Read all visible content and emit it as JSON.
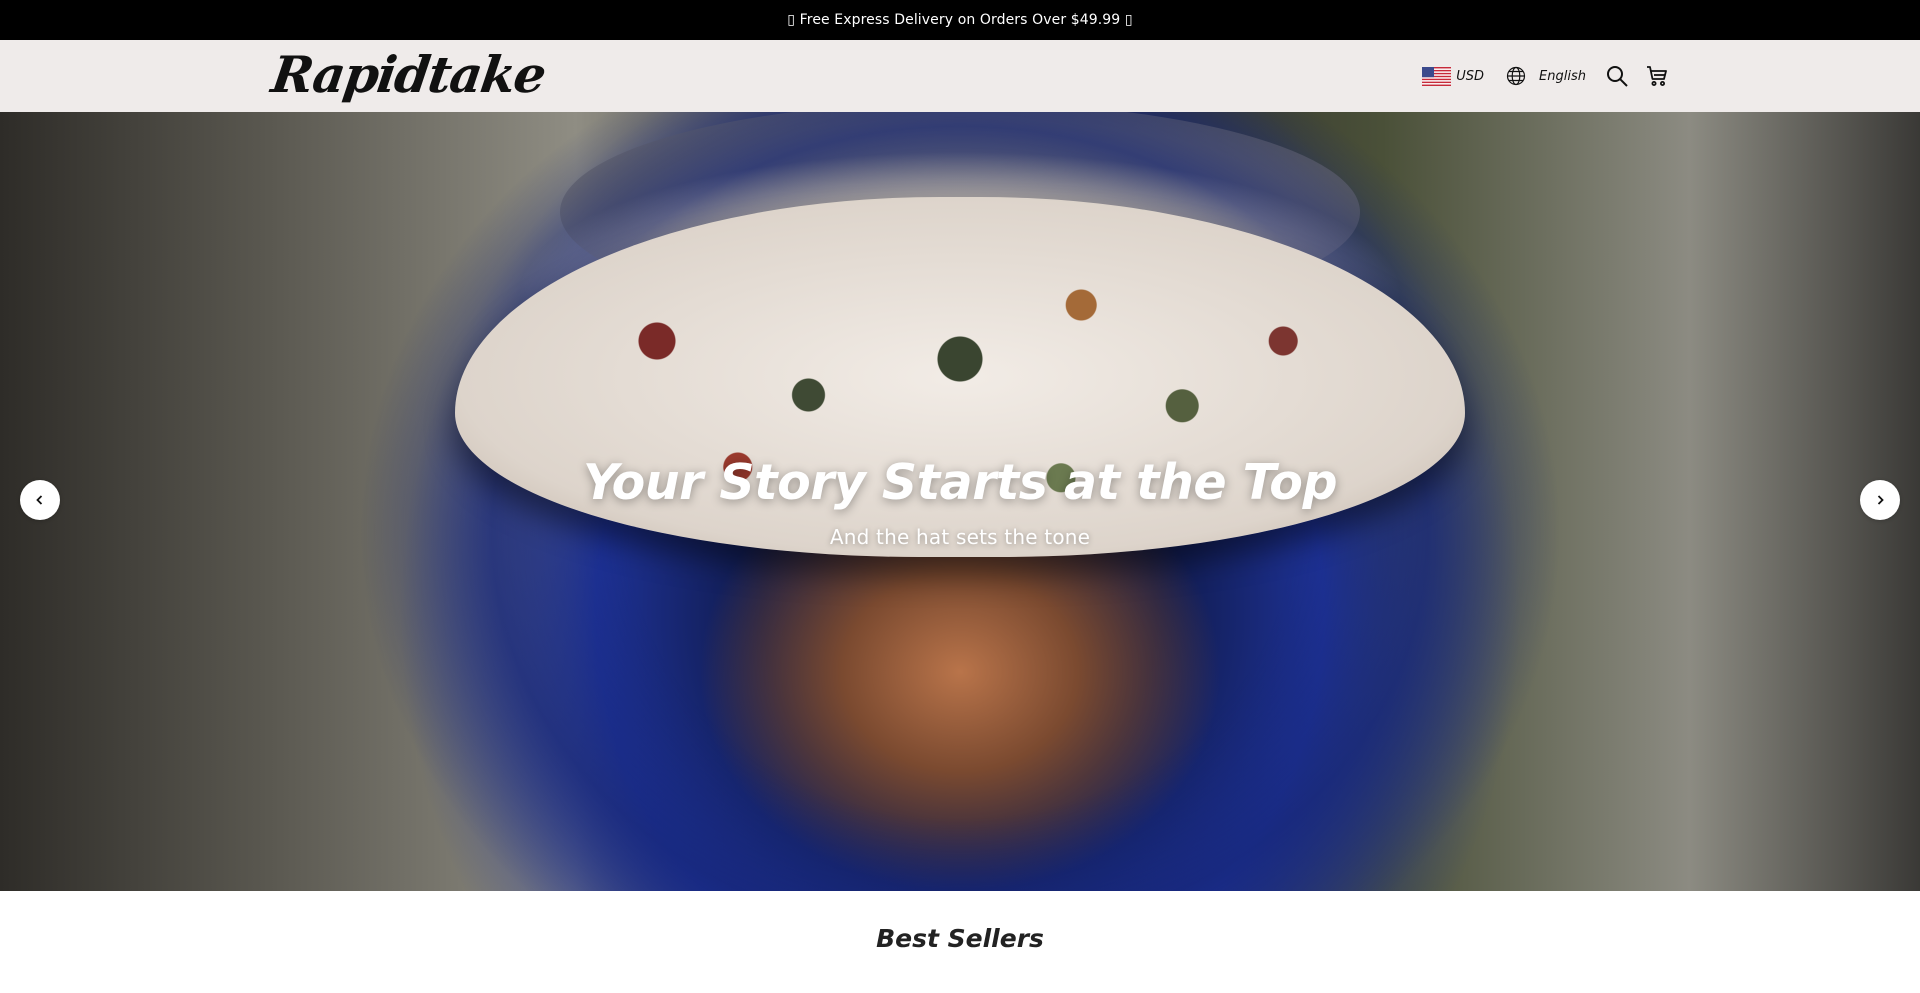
{
  "announcement": {
    "text": "▯ Free Express Delivery on Orders Over $49.99 ▯"
  },
  "header": {
    "logo": "Rapidtake",
    "currency": {
      "flag": "us-flag-icon",
      "label": "USD"
    },
    "language": {
      "icon": "globe-icon",
      "label": "English"
    },
    "icons": [
      "search-icon",
      "cart-icon"
    ]
  },
  "hero": {
    "title": "Your Story Starts at the Top",
    "subtitle": "And the hat sets the tone",
    "prev_icon": "chevron-left-icon",
    "next_icon": "chevron-right-icon"
  },
  "best_sellers": {
    "title": "Best Sellers"
  },
  "colors": {
    "announcement_bg": "#000000",
    "header_bg": "#efebea",
    "text_dark": "#111111",
    "hero_text": "#ffffff"
  }
}
